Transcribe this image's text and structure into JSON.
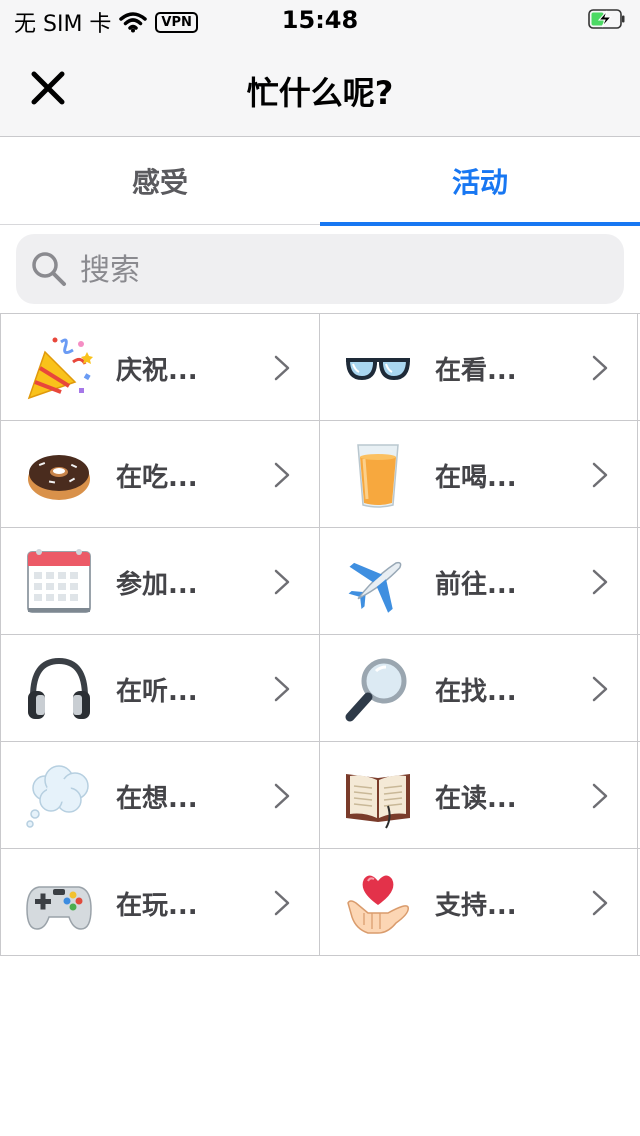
{
  "status_bar": {
    "carrier": "无 SIM 卡",
    "vpn": "VPN",
    "time": "15:48"
  },
  "nav": {
    "title": "忙什么呢?"
  },
  "tabs": [
    {
      "label": "感受",
      "selected": false
    },
    {
      "label": "活动",
      "selected": true
    }
  ],
  "search": {
    "placeholder": "搜索",
    "value": ""
  },
  "activities": [
    {
      "label": "庆祝...",
      "icon": "party-popper-icon"
    },
    {
      "label": "在看...",
      "icon": "glasses-icon"
    },
    {
      "label": "在吃...",
      "icon": "donut-icon"
    },
    {
      "label": "在喝...",
      "icon": "juice-glass-icon"
    },
    {
      "label": "参加...",
      "icon": "calendar-icon"
    },
    {
      "label": "前往...",
      "icon": "airplane-icon"
    },
    {
      "label": "在听...",
      "icon": "headphones-icon"
    },
    {
      "label": "在找...",
      "icon": "magnifying-glass-icon"
    },
    {
      "label": "在想...",
      "icon": "thought-bubble-icon"
    },
    {
      "label": "在读...",
      "icon": "open-book-icon"
    },
    {
      "label": "在玩...",
      "icon": "game-controller-icon"
    },
    {
      "label": "支持...",
      "icon": "heart-in-hand-icon"
    }
  ],
  "colors": {
    "accent": "#1877f2",
    "nav_background": "#f6f6f7",
    "divider": "#c9c9cc",
    "battery": "#4cd964"
  }
}
